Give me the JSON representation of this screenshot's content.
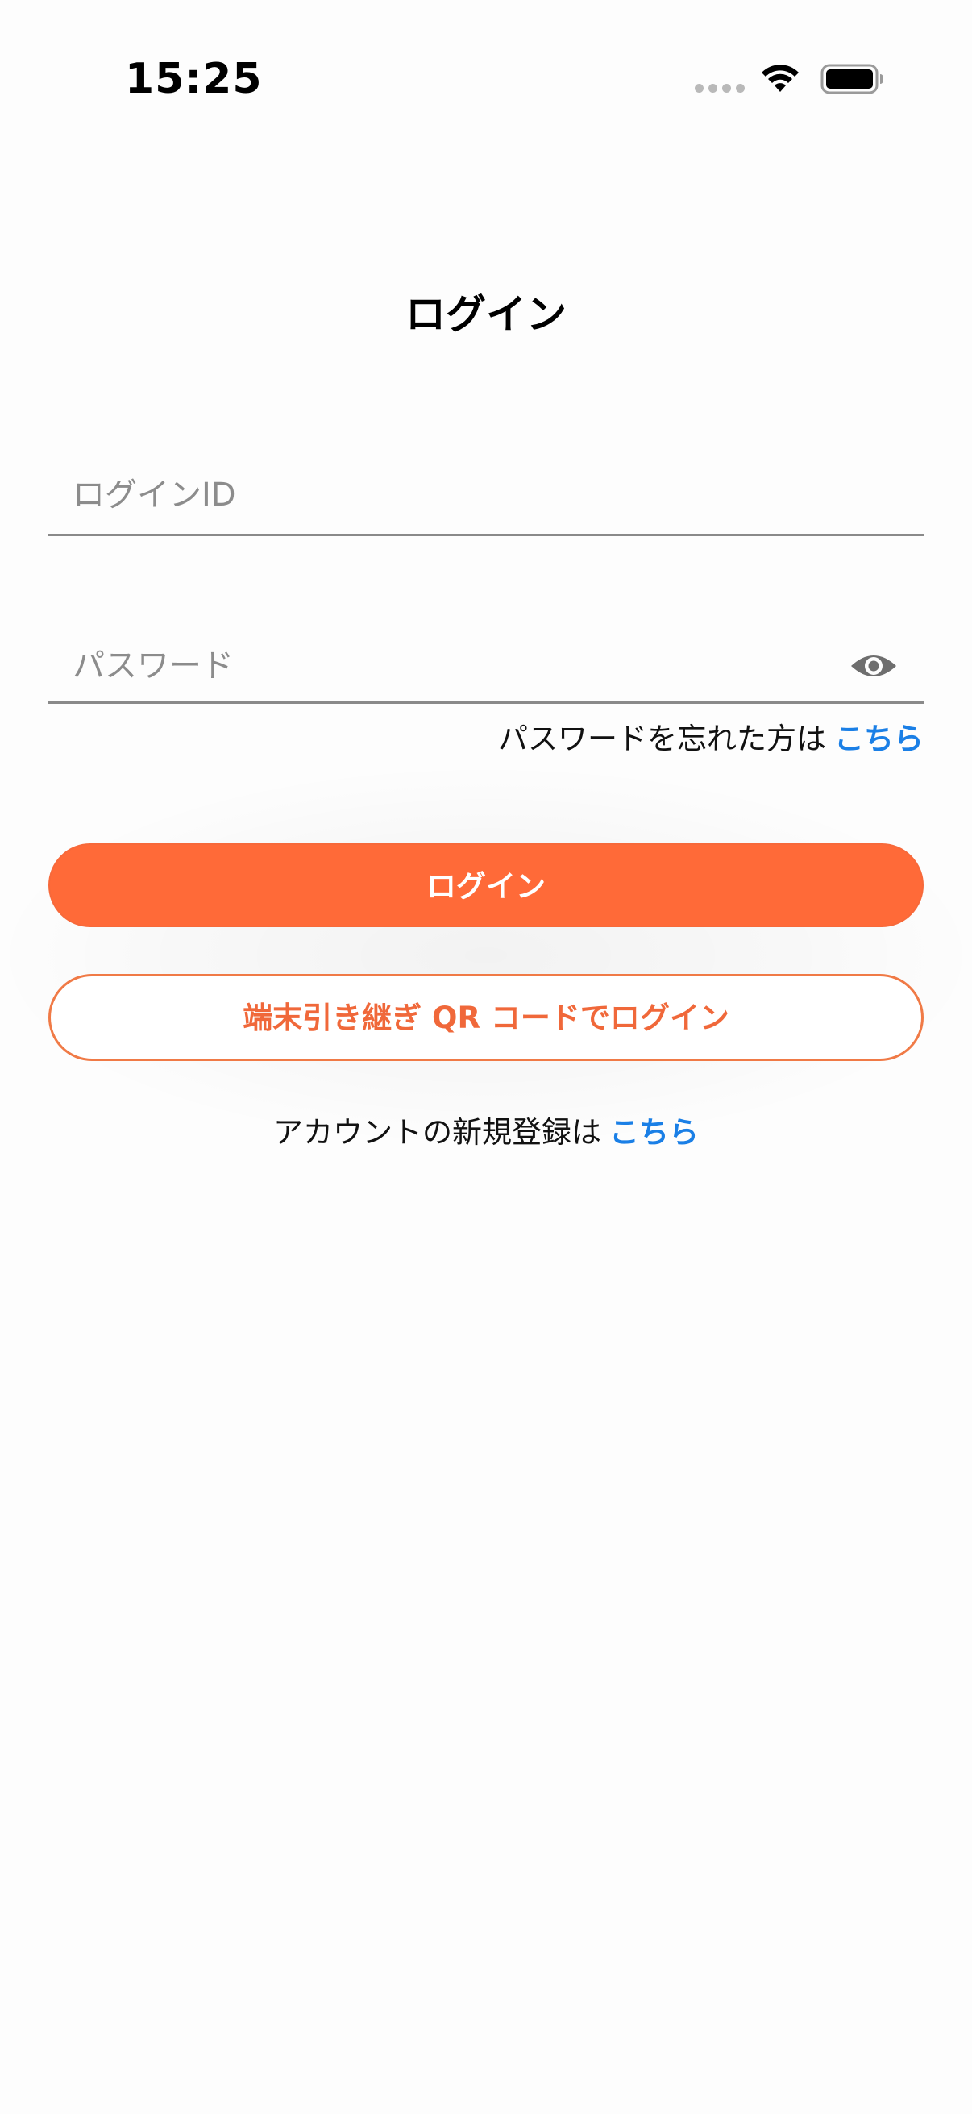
{
  "status_bar": {
    "time": "15:25",
    "icons": [
      "signal-dots-icon",
      "wifi-icon",
      "battery-icon"
    ]
  },
  "page": {
    "title": "ログイン"
  },
  "form": {
    "login_id": {
      "placeholder": "ログインID",
      "value": ""
    },
    "password": {
      "placeholder": "パスワード",
      "value": "",
      "toggle_icon": "eye-icon"
    },
    "forgot_text": "パスワードを忘れた方は",
    "forgot_link": "こちら"
  },
  "buttons": {
    "login_label": "ログイン",
    "qr_login_label": "端末引き継ぎ QR コードでログイン"
  },
  "register": {
    "text": "アカウントの新規登録は",
    "link": "こちら"
  },
  "colors": {
    "accent": "#ff6a38",
    "link": "#1a7fe6",
    "background": "#fdfdfd"
  }
}
